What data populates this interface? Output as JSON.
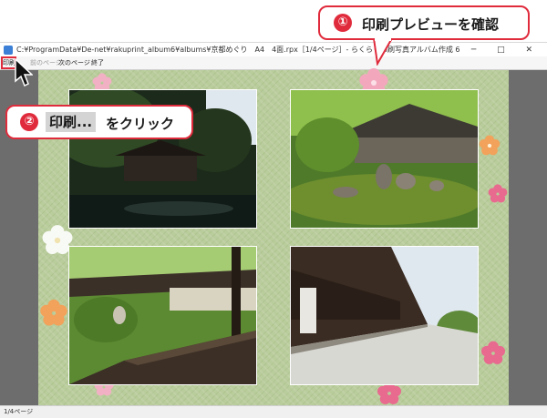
{
  "window": {
    "title": "C:¥ProgramData¥De-net¥rakuprint_album6¥albums¥京都めぐり　A4　4面.rpx［1/4ページ］- らくらく印刷写真アルバム作成 6",
    "controls": "─ □ ✕"
  },
  "toolbar": {
    "print_label": "印刷",
    "prev_label": "前のページ",
    "next_label": "次のページ",
    "close_label": "終了"
  },
  "status": {
    "page_indicator": "1/4ページ"
  },
  "callouts": {
    "step1_number": "①",
    "step1_text": "印刷プレビューを確認",
    "step2_number": "②",
    "step2_highlight": "印刷...",
    "step2_text": "をクリック"
  },
  "colors": {
    "accent_red": "#e02b3c",
    "page_background": "#b9cc9b",
    "preview_background": "#6d6d6d"
  }
}
